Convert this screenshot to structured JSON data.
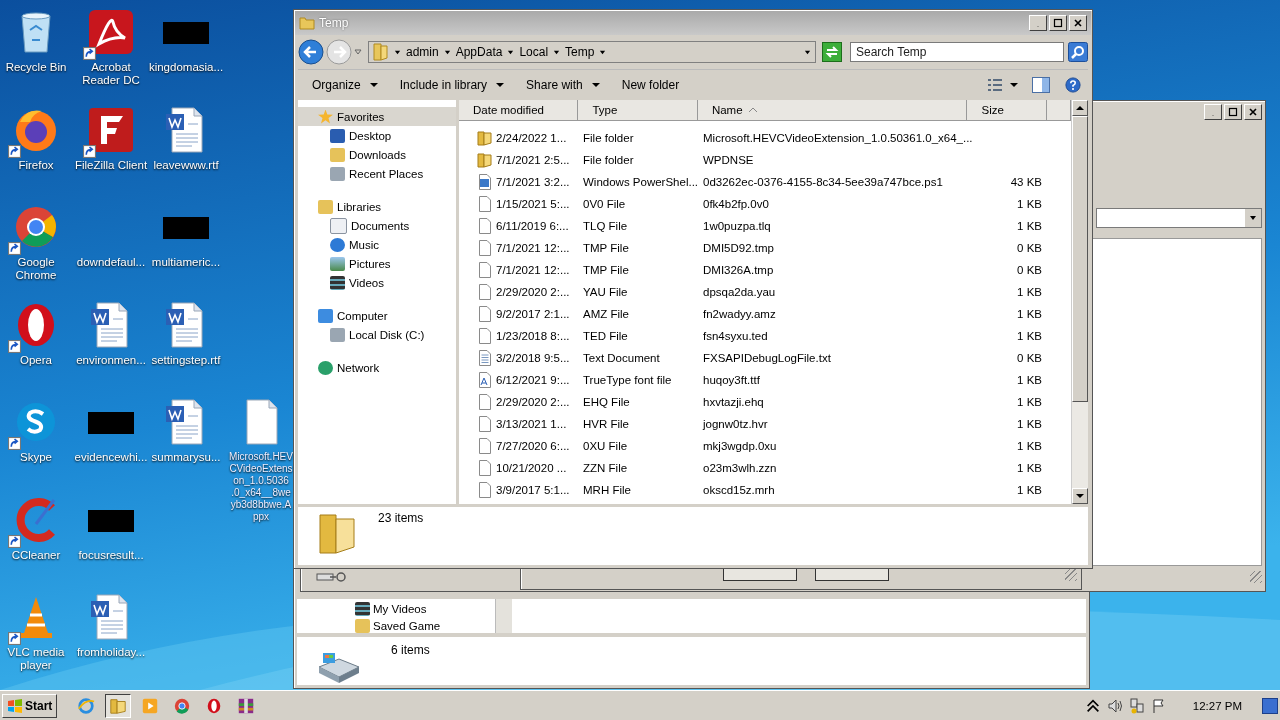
{
  "desktop_icons": [
    {
      "label": "Recycle Bin",
      "kind": "recycle",
      "shortcut": false
    },
    {
      "label": "Firefox",
      "kind": "firefox",
      "shortcut": true
    },
    {
      "label": "Google Chrome",
      "kind": "chrome",
      "shortcut": true
    },
    {
      "label": "Opera",
      "kind": "opera",
      "shortcut": true
    },
    {
      "label": "Skype",
      "kind": "skype",
      "shortcut": true
    },
    {
      "label": "CCleaner",
      "kind": "ccleaner",
      "shortcut": true
    },
    {
      "label": "VLC media player",
      "kind": "vlc",
      "shortcut": true
    },
    {
      "label": "Acrobat Reader DC",
      "kind": "acrobat",
      "shortcut": true
    },
    {
      "label": "FileZilla Client",
      "kind": "filezilla",
      "shortcut": true
    },
    {
      "label": "downdefaul...",
      "kind": "blank",
      "shortcut": false
    },
    {
      "label": "environmen...",
      "kind": "word",
      "shortcut": false
    },
    {
      "label": "evidencewhi...",
      "kind": "redacted",
      "shortcut": false
    },
    {
      "label": "focusresult...",
      "kind": "redacted",
      "shortcut": false
    },
    {
      "label": "fromholiday...",
      "kind": "word",
      "shortcut": false
    },
    {
      "label": "kingdomasia...",
      "kind": "redacted",
      "shortcut": false
    },
    {
      "label": "leavewww.rtf",
      "kind": "word",
      "shortcut": false
    },
    {
      "label": "multiameric...",
      "kind": "redacted",
      "shortcut": false
    },
    {
      "label": "settingstep.rtf",
      "kind": "word",
      "shortcut": false
    },
    {
      "label": "summarysu...",
      "kind": "word",
      "shortcut": false
    },
    {
      "label_lines": [
        "Microsoft.HEV",
        "CVideoExtens",
        "on_1.0.5036",
        ".0_x64__8we",
        "yb3d8bbwe.A",
        "ppx"
      ],
      "kind": "doc",
      "shortcut": false
    }
  ],
  "explorer": {
    "title": "Temp",
    "breadcrumb": [
      "admin",
      "AppData",
      "Local",
      "Temp"
    ],
    "search": {
      "placeholder": "Search Temp"
    },
    "toolbar": [
      {
        "label": "Organize",
        "dropdown": true
      },
      {
        "label": "Include in library",
        "dropdown": true
      },
      {
        "label": "Share with",
        "dropdown": true
      },
      {
        "label": "New folder",
        "dropdown": false
      }
    ],
    "nav": [
      {
        "label": "Favorites",
        "kind": "star",
        "selected": true,
        "children": [
          {
            "label": "Desktop",
            "kind": "desktop",
            "selected": false
          },
          {
            "label": "Downloads",
            "kind": "downloads",
            "selected": false
          },
          {
            "label": "Recent Places",
            "kind": "recent",
            "selected": false
          }
        ]
      },
      {
        "label": "Libraries",
        "kind": "libraries",
        "selected": false,
        "children": [
          {
            "label": "Documents",
            "kind": "documents",
            "selected": false
          },
          {
            "label": "Music",
            "kind": "music",
            "selected": false
          },
          {
            "label": "Pictures",
            "kind": "pictures",
            "selected": false
          },
          {
            "label": "Videos",
            "kind": "videos",
            "selected": false
          }
        ]
      },
      {
        "label": "Computer",
        "kind": "computer",
        "selected": false,
        "children": [
          {
            "label": "Local Disk (C:)",
            "kind": "disk",
            "selected": false
          }
        ]
      },
      {
        "label": "Network",
        "kind": "network",
        "selected": false
      }
    ],
    "columns": [
      {
        "label": "Date modified",
        "sorted": false
      },
      {
        "label": "Type",
        "sorted": false
      },
      {
        "label": "Name",
        "sorted": true
      },
      {
        "label": "Size",
        "sorted": false
      }
    ],
    "rows": [
      {
        "kind": "folder",
        "date": "2/24/2022 1...",
        "type": "File folder",
        "name": "Microsoft.HEVCVideoExtension_1.0.50361.0_x64_..."
      },
      {
        "kind": "folder",
        "date": "7/1/2021 2:5...",
        "type": "File folder",
        "name": "WPDNSE"
      },
      {
        "kind": "script",
        "date": "7/1/2021 3:2...",
        "type": "Windows PowerShel...",
        "name": "0d3262ec-0376-4155-8c34-5ee39a747bce.ps1",
        "size": "43 KB"
      },
      {
        "kind": "file",
        "date": "1/15/2021 5:...",
        "type": "0V0 File",
        "name": "0fk4b2fp.0v0",
        "size": "1 KB"
      },
      {
        "kind": "file",
        "date": "6/11/2019 6:...",
        "type": "TLQ File",
        "name": "1w0puzpa.tlq",
        "size": "1 KB"
      },
      {
        "kind": "file",
        "date": "7/1/2021 12:...",
        "type": "TMP File",
        "name": "DMI5D92.tmp",
        "size": "0 KB"
      },
      {
        "kind": "file",
        "date": "7/1/2021 12:...",
        "type": "TMP File",
        "name": "DMI326A.tmp",
        "size": "0 KB"
      },
      {
        "kind": "file",
        "date": "2/29/2020 2:...",
        "type": "YAU File",
        "name": "dpsqa2da.yau",
        "size": "1 KB"
      },
      {
        "kind": "file",
        "date": "9/2/2017 2:1...",
        "type": "AMZ File",
        "name": "fn2wadyy.amz",
        "size": "1 KB"
      },
      {
        "kind": "file",
        "date": "1/23/2018 8:...",
        "type": "TED File",
        "name": "fsn4syxu.ted",
        "size": "1 KB"
      },
      {
        "kind": "text",
        "date": "3/2/2018 9:5...",
        "type": "Text Document",
        "name": "FXSAPIDebugLogFile.txt",
        "size": "0 KB"
      },
      {
        "kind": "font",
        "date": "6/12/2021 9:...",
        "type": "TrueType font file",
        "name": "huqoy3ft.ttf",
        "size": "1 KB"
      },
      {
        "kind": "file",
        "date": "2/29/2020 2:...",
        "type": "EHQ File",
        "name": "hxvtazji.ehq",
        "size": "1 KB"
      },
      {
        "kind": "file",
        "date": "3/13/2021 1...",
        "type": "HVR File",
        "name": "jognw0tz.hvr",
        "size": "1 KB"
      },
      {
        "kind": "file",
        "date": "7/27/2020 6:...",
        "type": "0XU File",
        "name": "mkj3wgdp.0xu",
        "size": "1 KB"
      },
      {
        "kind": "file",
        "date": "10/21/2020 ...",
        "type": "ZZN File",
        "name": "o23m3wlh.zzn",
        "size": "1 KB"
      },
      {
        "kind": "file",
        "date": "3/9/2017 5:1...",
        "type": "MRH File",
        "name": "okscd15z.mrh",
        "size": "1 KB"
      }
    ],
    "status": "23 items"
  },
  "back_explorer": {
    "nav": [
      {
        "label": "My Videos",
        "kind": "videos"
      },
      {
        "label": "Saved Game",
        "kind": "saved"
      }
    ],
    "status": "6 items"
  },
  "taskbar": {
    "start": "Start",
    "apps": [
      {
        "kind": "ie",
        "active": false
      },
      {
        "kind": "explorer",
        "active": true
      },
      {
        "kind": "media",
        "active": false
      },
      {
        "kind": "chrome",
        "active": false
      },
      {
        "kind": "opera",
        "active": false
      },
      {
        "kind": "archive",
        "active": false
      }
    ],
    "clock": "12:27 PM"
  }
}
